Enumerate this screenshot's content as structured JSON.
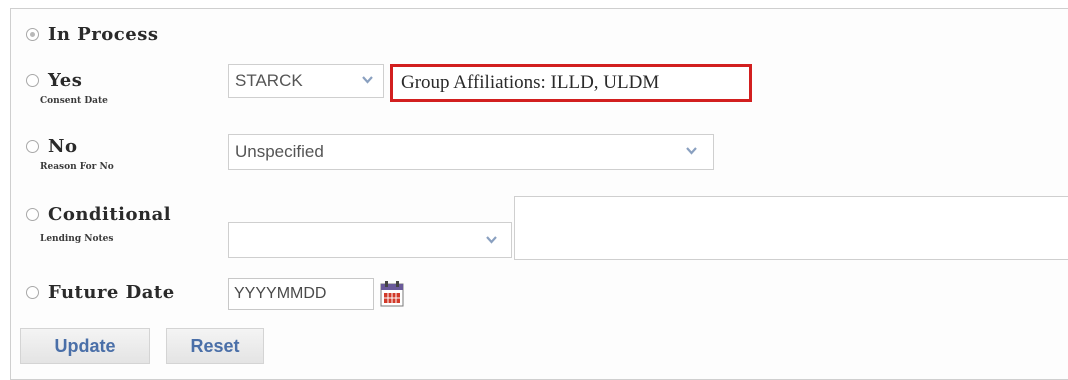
{
  "options": {
    "in_process": {
      "label": "In Process",
      "selected": true
    },
    "yes": {
      "label": "Yes",
      "sublabel": "Consent Date"
    },
    "no": {
      "label": "No",
      "sublabel": "Reason For No"
    },
    "conditional": {
      "label": "Conditional",
      "sublabel": "Lending Notes"
    },
    "future_date": {
      "label": "Future Date"
    }
  },
  "yes_row": {
    "select_value": "STARCK",
    "affiliations": "Group Affiliations: ILLD, ULDM"
  },
  "no_row": {
    "reason_value": "Unspecified"
  },
  "conditional_row": {
    "select_value": "",
    "notes_value": ""
  },
  "future_row": {
    "date_placeholder": "YYYYMMDD"
  },
  "buttons": {
    "update": "Update",
    "reset": "Reset"
  },
  "colors": {
    "highlight_border": "#d21f1f",
    "button_text": "#4a6fa8"
  }
}
